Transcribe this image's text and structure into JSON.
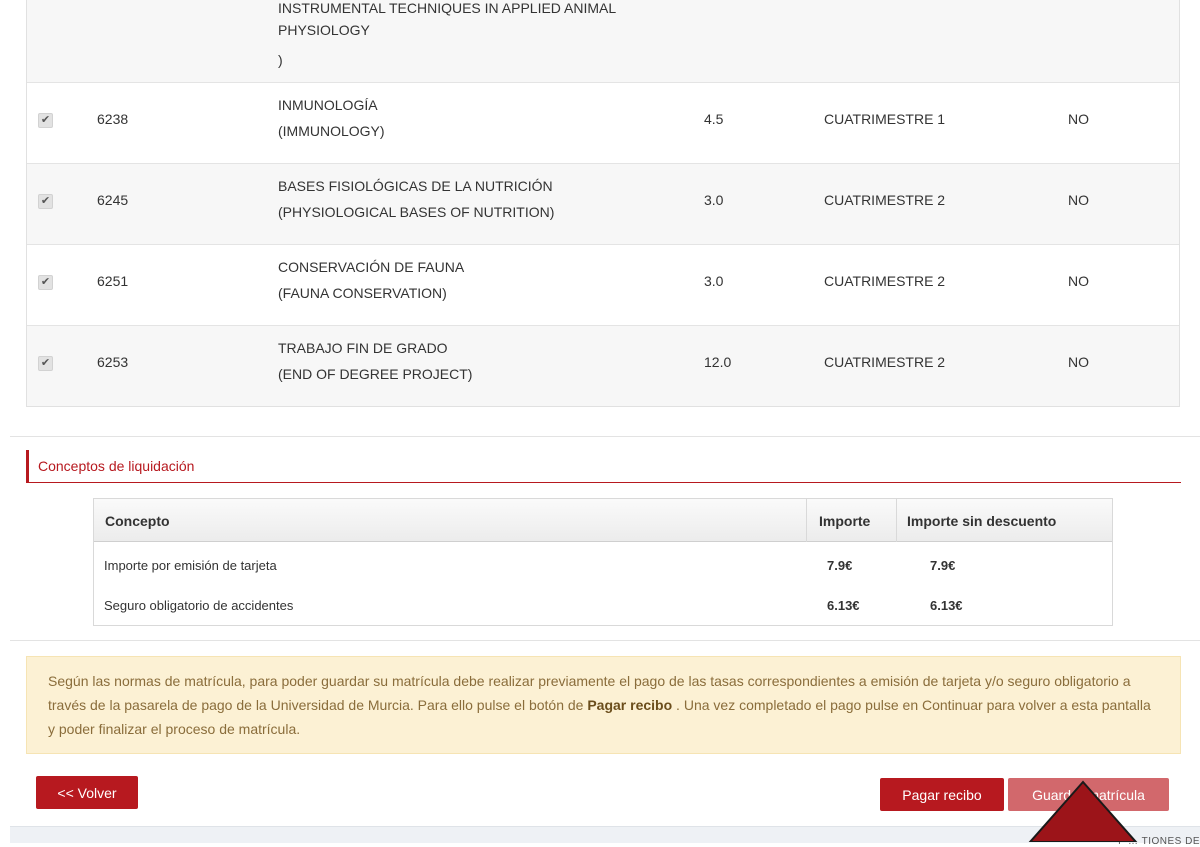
{
  "top_course": {
    "name_lines": [
      "INSTRUMENTAL TECHNIQUES IN APPLIED ANIMAL",
      "PHYSIOLOGY",
      ")"
    ]
  },
  "courses": [
    {
      "code": "6238",
      "name_es": "INMUNOLOGÍA",
      "name_en": "(IMMUNOLOGY)",
      "credits": "4.5",
      "period": "CUATRIMESTRE 1",
      "flag": "NO",
      "checked": true
    },
    {
      "code": "6245",
      "name_es": "BASES FISIOLÓGICAS DE LA NUTRICIÓN",
      "name_en": "(PHYSIOLOGICAL BASES OF NUTRITION)",
      "credits": "3.0",
      "period": "CUATRIMESTRE 2",
      "flag": "NO",
      "checked": true
    },
    {
      "code": "6251",
      "name_es": "CONSERVACIÓN DE FAUNA",
      "name_en": "(FAUNA CONSERVATION)",
      "credits": "3.0",
      "period": "CUATRIMESTRE 2",
      "flag": "NO",
      "checked": true
    },
    {
      "code": "6253",
      "name_es": "TRABAJO FIN DE GRADO",
      "name_en": "(END OF DEGREE PROJECT)",
      "credits": "12.0",
      "period": "CUATRIMESTRE 2",
      "flag": "NO",
      "checked": true
    }
  ],
  "fees_section": {
    "title": "Conceptos de liquidación",
    "headers": {
      "concept": "Concepto",
      "amount": "Importe",
      "amount_no_discount": "Importe sin descuento"
    },
    "rows": [
      {
        "concept": "Importe por emisión de tarjeta",
        "amount": "7.9€",
        "amount_no_discount": "7.9€"
      },
      {
        "concept": "Seguro obligatorio de accidentes",
        "amount": "6.13€",
        "amount_no_discount": "6.13€"
      }
    ]
  },
  "notice": {
    "part1": "Según las normas de matrícula, para poder guardar su matrícula debe realizar previamente el pago de las tasas correspondientes a emisión de tarjeta y/o seguro obligatorio a través de la pasarela de pago de la Universidad de Murcia. Para ello pulse el botón de ",
    "bold": "Pagar recibo",
    "part2": " . Una vez completado el pago pulse en Continuar para volver a esta pantalla y poder finalizar el proceso de matrícula."
  },
  "buttons": {
    "back": "<< Volver",
    "pay": "Pagar recibo",
    "save": "Guardar matrícula"
  },
  "footer_text": "F         …  TIONES DE",
  "colors": {
    "accent": "#b7191f",
    "save_disabled": "#d2686c",
    "notice_bg": "#fcf1d4",
    "notice_text": "#8a6d3b"
  },
  "icons": {
    "checkbox": "check-icon",
    "pointer": "cursor-arrow-icon"
  }
}
